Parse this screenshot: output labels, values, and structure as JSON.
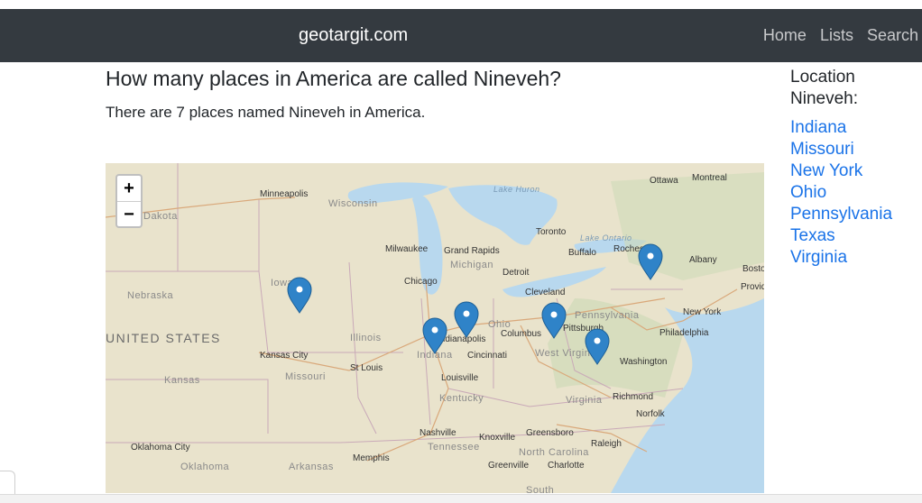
{
  "navbar": {
    "brand": "geotargit.com",
    "links": [
      "Home",
      "Lists",
      "Search"
    ]
  },
  "main": {
    "title": "How many places in America are called Nineveh?",
    "summary": "There are 7 places named Nineveh in America."
  },
  "sidebar": {
    "title": "Location Nineveh:",
    "states": [
      "Indiana",
      "Missouri",
      "New York",
      "Ohio",
      "Pennsylvania",
      "Texas",
      "Virginia"
    ],
    "link_color": "#1a73e8"
  },
  "map": {
    "zoom_in_label": "+",
    "zoom_out_label": "−",
    "marker_color": "#2f83c8",
    "labels": {
      "cities": [
        "Minneapolis",
        "Ottawa",
        "Montreal",
        "Toronto",
        "Buffalo",
        "Rochester",
        "Albany",
        "Boston",
        "Providence",
        "Milwaukee",
        "Grand Rapids",
        "Detroit",
        "Chicago",
        "Cleveland",
        "Pittsburgh",
        "Columbus",
        "Indianapolis",
        "Cincinnati",
        "New York",
        "Philadelphia",
        "Washington",
        "Kansas City",
        "St Louis",
        "Louisville",
        "Richmond",
        "Norfolk",
        "Nashville",
        "Knoxville",
        "Greensboro",
        "Raleigh",
        "Charlotte",
        "Greenville",
        "Memphis",
        "Oklahoma City"
      ],
      "regions": [
        "Wisconsin",
        "Dakota",
        "Iowa",
        "Nebraska",
        "Illinois",
        "Indiana",
        "Ohio",
        "Pennsylvania",
        "Michigan",
        "Missouri",
        "Kansas",
        "Kentucky",
        "West Virginia",
        "Virginia",
        "Tennessee",
        "North Carolina",
        "Oklahoma",
        "Arkansas",
        "South"
      ],
      "country": "UNITED STATES",
      "lakes": [
        "Lake Huron",
        "Lake Ontario"
      ]
    }
  }
}
